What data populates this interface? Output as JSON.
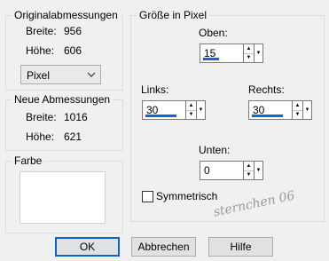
{
  "original": {
    "title": "Originalabmessungen",
    "breite_label": "Breite:",
    "breite_value": "956",
    "hoehe_label": "Höhe:",
    "hoehe_value": "606",
    "unit_select": "Pixel"
  },
  "neue": {
    "title": "Neue Abmessungen",
    "breite_label": "Breite:",
    "breite_value": "1016",
    "hoehe_label": "Höhe:",
    "hoehe_value": "621"
  },
  "farbe": {
    "title": "Farbe",
    "color": "#ffffff"
  },
  "groesse": {
    "title": "Größe in Pixel",
    "oben_label": "Oben:",
    "oben_value": "15",
    "links_label": "Links:",
    "links_value": "30",
    "rechts_label": "Rechts:",
    "rechts_value": "30",
    "unten_label": "Unten:",
    "unten_value": "0",
    "symmetrisch_label": "Symmetrisch",
    "symmetrisch_checked": false
  },
  "buttons": {
    "ok": "OK",
    "cancel": "Abbrechen",
    "help": "Hilfe"
  },
  "watermark_text": "sternchen 06",
  "colors": {
    "accent": "#0a64c8",
    "background": "#f0f0f0"
  }
}
